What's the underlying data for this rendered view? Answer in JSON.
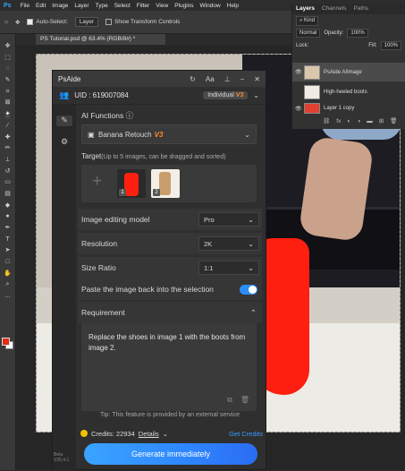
{
  "menubar": {
    "logo": "Ps",
    "items": [
      "File",
      "Edit",
      "Image",
      "Layer",
      "Type",
      "Select",
      "Filter",
      "View",
      "Plugins",
      "Window",
      "Help"
    ]
  },
  "options": {
    "move_icon": "✥",
    "auto_select_label": "Auto-Select:",
    "auto_select_value": "Layer",
    "show_transform_label": "Show Transform Controls"
  },
  "document_tab": "PS Tutorial.psd @ 63.4% (RGB/8#) *",
  "layers_panel": {
    "tabs": [
      "Layers",
      "Channels",
      "Paths"
    ],
    "kind_label": "Kind",
    "blend_mode": "Normal",
    "opacity_label": "Opacity:",
    "opacity_value": "100%",
    "lock_label": "Lock:",
    "fill_label": "Fill:",
    "fill_value": "100%",
    "layers": [
      {
        "name": "PsAide AIImage"
      },
      {
        "name": "High-heeled boots"
      },
      {
        "name": "Layer 1 copy"
      }
    ]
  },
  "plugin": {
    "title": "PsAide",
    "uid_label": "UID : 619007084",
    "plan": "Individual",
    "plan_version": "V3",
    "ai_functions_label": "AI Functions",
    "function_selected": "Banana Retouch",
    "function_version": "V3",
    "target_label": "Target",
    "target_hint": "(Up to 5 images, can be dragged and sorted)",
    "plus": "+",
    "image_badges": [
      "1",
      "2"
    ],
    "rows": {
      "model_label": "Image editing model",
      "model_value": "Pro",
      "resolution_label": "Resolution",
      "resolution_value": "2K",
      "ratio_label": "Size Ratio",
      "ratio_value": "1:1",
      "paste_label": "Paste the image back into the selection",
      "paste_on": true
    },
    "requirement_label": "Requirement",
    "requirement_text": "Replace the shoes in image 1 with the boots from image 2.",
    "tip": "Tip: This feature is provided by an external service",
    "credits_label": "Credits: 22934",
    "details_label": "Details",
    "get_credits_label": "Get Credits",
    "generate_label": "Generate immediately"
  },
  "status": {
    "line1": "Beta",
    "line2": "V25.4.1"
  },
  "colors": {
    "accent": "#2e86ff",
    "version_orange": "#ff8a2d",
    "foreground_swatch": "#e62a15",
    "background_swatch": "#ffffff"
  }
}
